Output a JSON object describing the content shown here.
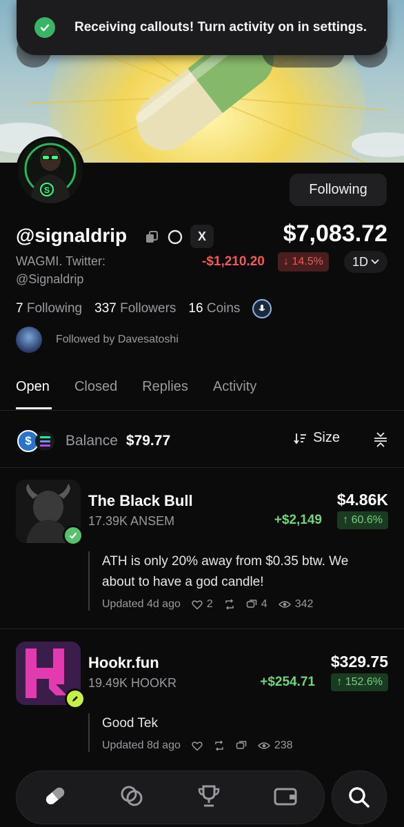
{
  "toast": {
    "text": "Receiving callouts! Turn activity on in settings."
  },
  "profile": {
    "handle": "@signaldrip",
    "bio": "WAGMI. Twitter: @Signaldrip",
    "portfolio_value": "$7,083.72",
    "change_value": "-$1,210.20",
    "change_pct": "↓ 14.5%",
    "range": "1D",
    "follow_button": "Following",
    "x_label": "X"
  },
  "stats": {
    "following_count": "7",
    "following_label": "Following",
    "followers_count": "337",
    "followers_label": "Followers",
    "coins_count": "16",
    "coins_label": "Coins"
  },
  "followed_by": "Followed by Davesatoshi",
  "tabs": [
    "Open",
    "Closed",
    "Replies",
    "Activity"
  ],
  "balance": {
    "label": "Balance",
    "value": "$79.77",
    "sort_label": "Size",
    "usdc_symbol": "$"
  },
  "positions": [
    {
      "name": "The Black Bull",
      "qty": "17.39K ANSEM",
      "value": "$4.86K",
      "gain": "+$2,149",
      "pct": "↑ 60.6%",
      "quote": "ATH is only 20% away from $0.35 btw. We about to have a god candle!",
      "updated": "Updated 4d ago",
      "likes": "2",
      "comments": "4",
      "views": "342"
    },
    {
      "name": "Hookr.fun",
      "qty": "19.49K HOOKR",
      "value": "$329.75",
      "gain": "+$254.71",
      "pct": "↑ 152.6%",
      "quote": "Good Tek",
      "updated": "Updated 8d ago",
      "views": "238"
    }
  ],
  "colors": {
    "accent_green": "#6fd67d",
    "accent_red": "#ef5a5a",
    "background": "#0b0b0c"
  }
}
